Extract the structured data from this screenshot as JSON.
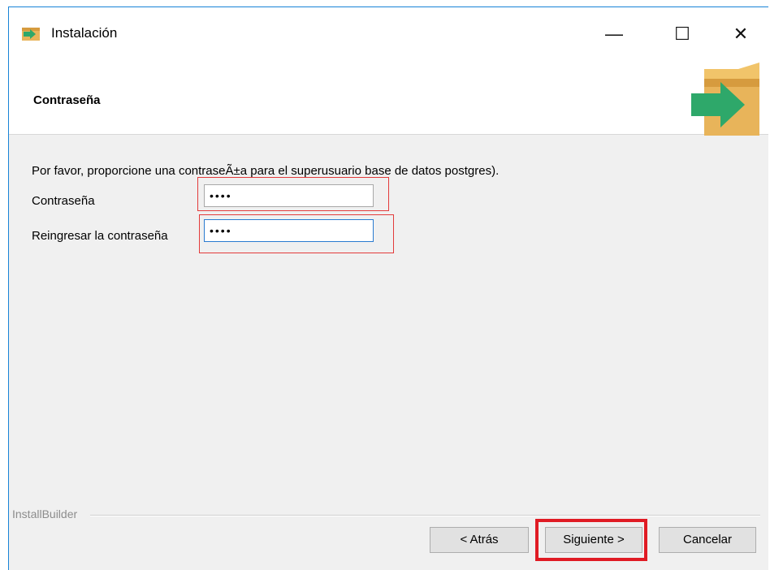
{
  "window": {
    "title": "Instalación",
    "controls": {
      "minimize": "—",
      "maximize": "☐",
      "close": "✕"
    }
  },
  "header": {
    "title": "Contraseña",
    "icon": "installer-box-arrow-icon"
  },
  "form": {
    "prompt": "Por favor, proporcione una contraseÃ±a para el superusuario base de datos postgres).",
    "password_label": "Contraseña",
    "password_value": "••••",
    "confirm_label": "Reingresar la contraseña",
    "confirm_value": "••••"
  },
  "footer": {
    "brand": "InstallBuilder",
    "back_label": "< Atrás",
    "next_label": "Siguiente >",
    "cancel_label": "Cancelar"
  },
  "colors": {
    "highlight": "#e01b24",
    "titlebar_border": "#1883d7",
    "window_bg": "#f0f0f0"
  }
}
